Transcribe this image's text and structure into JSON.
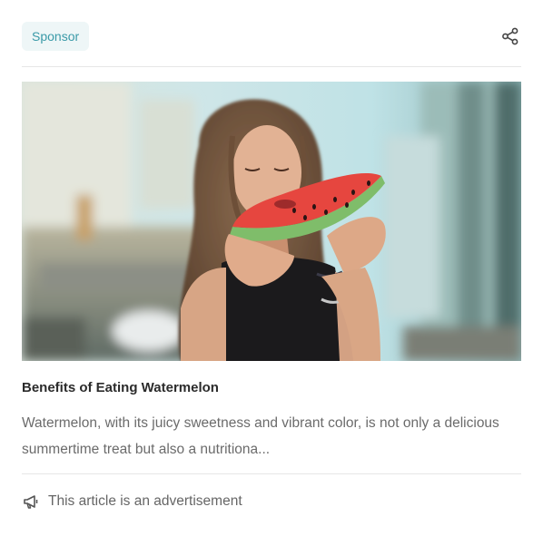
{
  "header": {
    "badge_label": "Sponsor",
    "share_icon": "share-icon"
  },
  "article": {
    "image_icon": "watermelon-photo",
    "title": "Benefits of Eating Watermelon",
    "excerpt": "Watermelon, with its juicy sweetness and vibrant color, is not only a delicious summertime treat but also a nutritiona..."
  },
  "footer": {
    "icon": "megaphone-icon",
    "text": "This article is an advertisement"
  },
  "colors": {
    "badge_bg": "#eef6f7",
    "badge_text": "#3a9aa8",
    "title": "#2b2b2b",
    "body_text": "#6b6b6b",
    "divider": "#e6e6e6"
  }
}
